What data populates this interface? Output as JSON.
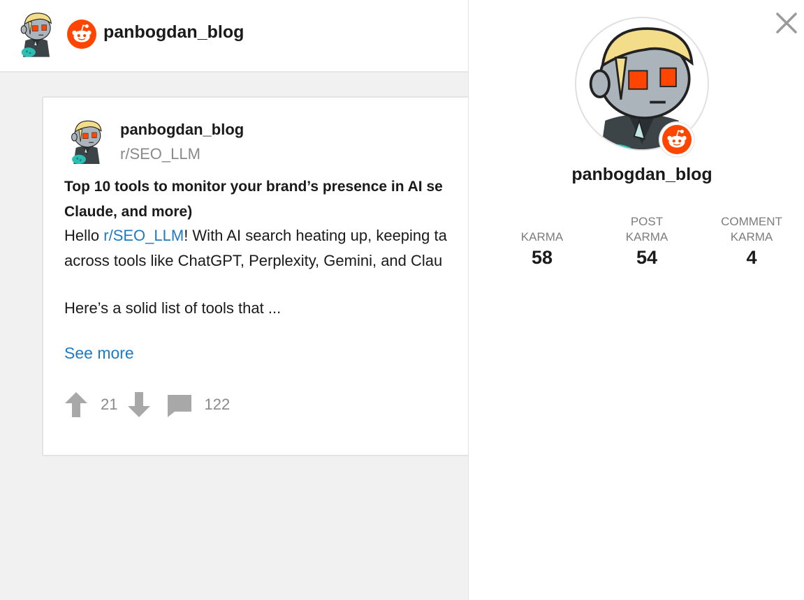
{
  "header": {
    "title": "panbogdan_blog"
  },
  "post": {
    "author": "panbogdan_blog",
    "subreddit": "r/SEO_LLM",
    "title_line1": "Top 10 tools to monitor your brand’s presence in AI se",
    "title_line2": "Claude, and more)",
    "body_line1_prefix": "Hello ",
    "body_line1_link": "r/SEO_LLM",
    "body_line1_suffix": "! With AI search heating up, keeping ta",
    "body_line2": "across tools like ChatGPT, Perplexity, Gemini, and Clau",
    "body_para2": "Here’s a solid list of tools that ...",
    "see_more_label": "See more",
    "upvote_count": "21",
    "comment_count": "122"
  },
  "profile": {
    "username": "panbogdan_blog",
    "stats": [
      {
        "label_line1": "",
        "label_line2": "KARMA",
        "value": "58"
      },
      {
        "label_line1": "POST",
        "label_line2": "KARMA",
        "value": "54"
      },
      {
        "label_line1": "COMMENT",
        "label_line2": "KARMA",
        "value": "4"
      }
    ]
  },
  "icons": {
    "close": "close-icon",
    "upvote": "upvote-arrow-icon",
    "downvote": "downvote-arrow-icon",
    "comment": "comment-bubble-icon",
    "reddit": "reddit-logo-icon"
  },
  "colors": {
    "reddit_orange": "#ff4500",
    "link_blue": "#1f7ac4",
    "muted_gray": "#8a8a8a",
    "avatar_teal": "#2bbfb3"
  }
}
